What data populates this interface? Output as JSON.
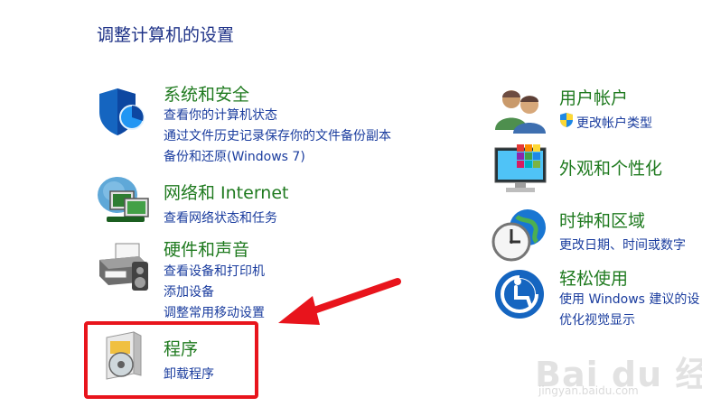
{
  "page": {
    "title": "调整计算机的设置"
  },
  "categories": {
    "security": {
      "title": "系统和安全",
      "links": [
        "查看你的计算机状态",
        "通过文件历史记录保存你的文件备份副本",
        "备份和还原(Windows 7)"
      ]
    },
    "network": {
      "title": "网络和 Internet",
      "links": [
        "查看网络状态和任务"
      ]
    },
    "hardware": {
      "title": "硬件和声音",
      "links": [
        "查看设备和打印机",
        "添加设备",
        "调整常用移动设置"
      ]
    },
    "programs": {
      "title": "程序",
      "links": [
        "卸载程序"
      ]
    },
    "accounts": {
      "title": "用户帐户",
      "links": [
        "更改帐户类型"
      ]
    },
    "appearance": {
      "title": "外观和个性化",
      "links": []
    },
    "clock": {
      "title": "时钟和区域",
      "links": [
        "更改日期、时间或数字"
      ]
    },
    "ease": {
      "title": "轻松使用",
      "links": [
        "使用 Windows 建议的设",
        "优化视觉显示"
      ]
    }
  },
  "watermark": {
    "logo": "Bai du 经验",
    "url": "jingyan.baidu.com"
  },
  "colors": {
    "category_title": "#1f7a1f",
    "link": "#1a3c9e",
    "page_title": "#1e3287",
    "highlight": "#e8141c"
  },
  "icons": {
    "security": "shield-icon",
    "network": "network-monitors-icon",
    "hardware": "printer-icon",
    "programs": "program-disc-icon",
    "accounts": "users-icon",
    "appearance": "display-colors-icon",
    "clock": "clock-globe-icon",
    "ease": "ease-of-access-icon"
  }
}
